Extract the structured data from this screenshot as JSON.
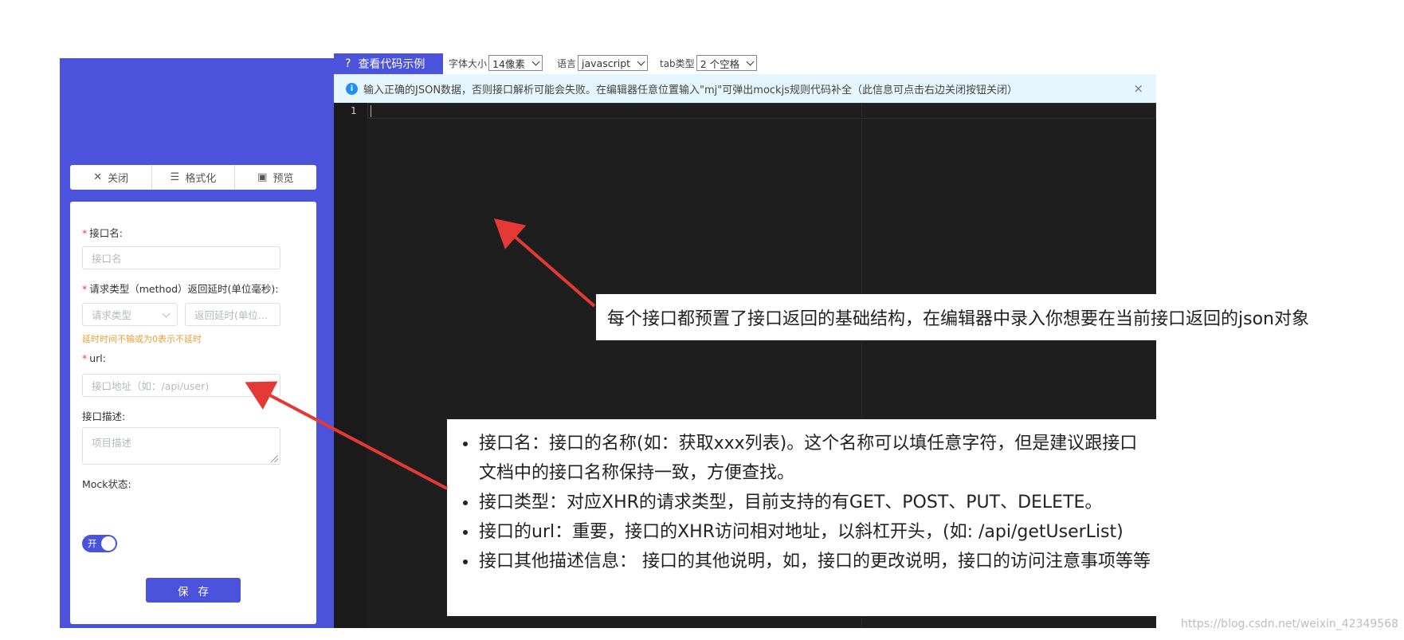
{
  "editor_header": {
    "code_example_label": "查看代码示例",
    "font_size": {
      "label": "字体大小",
      "value": "14像素"
    },
    "language": {
      "label": "语言",
      "value": "javascript"
    },
    "tab_type": {
      "label": "tab类型",
      "value": "2 个空格"
    }
  },
  "info_bar": {
    "message": "输入正确的JSON数据，否则接口解析可能会失败。在编辑器任意位置输入\"mj\"可弹出mockjs规则代码补全（此信息可点击右边关闭按钮关闭）",
    "close_label": "×"
  },
  "editor": {
    "line_number": "1"
  },
  "toolbar": {
    "close_label": "关闭",
    "format_label": "格式化",
    "preview_label": "预览"
  },
  "form": {
    "required_mark": "*",
    "name": {
      "label": "接口名:",
      "placeholder": "接口名"
    },
    "method_delay_label": "请求类型（method）返回延时(单位毫秒):",
    "method": {
      "placeholder": "请求类型"
    },
    "delay": {
      "placeholder": "返回延时(单位..."
    },
    "delay_hint": "延时时间不输或为0表示不延时",
    "url": {
      "label": "url:",
      "placeholder": "接口地址（如：/api/user)"
    },
    "description": {
      "label": "接口描述:",
      "placeholder": "项目描述"
    },
    "mock_status": {
      "label": "Mock状态:",
      "switch_text": "开",
      "enabled": true
    },
    "save_label": "保存"
  },
  "annotations": {
    "editor_note": "每个接口都预置了接口返回的基础结构，在编辑器中录入你想要在当前接口返回的json对象",
    "field_notes": [
      "接口名：接口的名称(如：获取xxx列表)。这个名称可以填任意字符，但是建议跟接口文档中的接口名称保持一致，方便查找。",
      "接口类型：对应XHR的请求类型，目前支持的有GET、POST、PUT、DELETE。",
      "接口的url：重要，接口的XHR访问相对地址，以斜杠开头，(如: /api/getUserList)",
      "接口其他描述信息： 接口的其他说明，如，接口的更改说明，接口的访问注意事项等等"
    ]
  },
  "watermark": "https://blog.csdn.net/weixin_42349568",
  "colors": {
    "primary": "#4b53dd",
    "editor_bg": "#1e1e1e",
    "info_bg": "#e6f6ff",
    "arrow": "#e53935"
  },
  "icons": [
    "question-icon",
    "close-icon",
    "format-icon",
    "preview-icon",
    "info-icon",
    "chevron-down-icon",
    "arrow-annotation"
  ]
}
